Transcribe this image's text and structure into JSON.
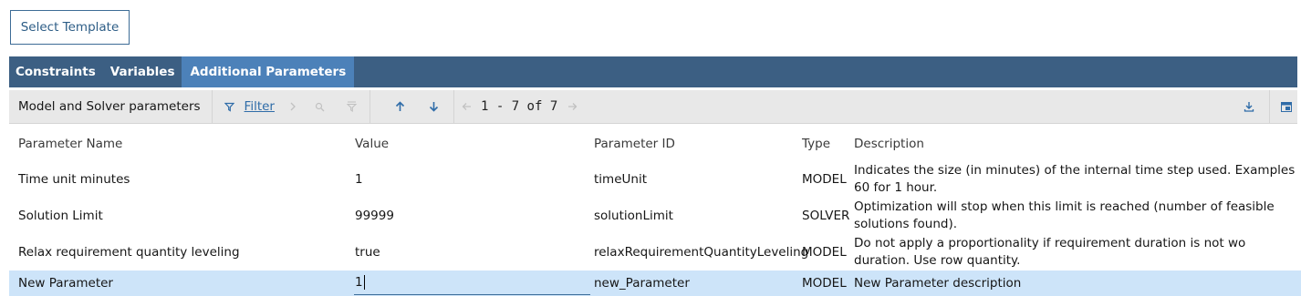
{
  "select_template_label": "Select Template",
  "tabs": [
    {
      "label": "Constraints",
      "active": false
    },
    {
      "label": "Variables",
      "active": false
    },
    {
      "label": "Additional Parameters",
      "active": true
    }
  ],
  "toolbar": {
    "title": "Model and Solver parameters",
    "filter_label": "Filter",
    "pager_text": "1 - 7 of 7",
    "icons": [
      "filter-icon",
      "chevron-right-icon",
      "search-icon",
      "clear-filter-icon",
      "arrow-up-icon",
      "arrow-down-icon",
      "arrow-left-icon",
      "arrow-right-icon",
      "download-icon",
      "panel-icon"
    ]
  },
  "columns": {
    "name": "Parameter Name",
    "value": "Value",
    "id": "Parameter ID",
    "type": "Type",
    "description": "Description"
  },
  "rows": [
    {
      "name": "Time unit minutes",
      "value": "1",
      "id": "timeUnit",
      "type": "MODEL",
      "description": "Indicates the size (in minutes) of the internal time step used. Examples 60 for 1 hour."
    },
    {
      "name": "Solution Limit",
      "value": "99999",
      "id": "solutionLimit",
      "type": "SOLVER",
      "description": "Optimization will stop when this limit is reached (number of feasible solutions found)."
    },
    {
      "name": "Relax requirement quantity leveling",
      "value": "true",
      "id": "relaxRequirementQuantityLeveling",
      "type": "MODEL",
      "description": "Do not apply a proportionality if requirement duration is not wo duration. Use row quantity."
    },
    {
      "name": "New Parameter",
      "value": "1",
      "id": "new_Parameter",
      "type": "MODEL",
      "description": "New Parameter description",
      "selected": true,
      "editing": true
    }
  ],
  "colors": {
    "tabbar": "#3c5f83",
    "active_tab": "#4c81b9",
    "toolbar_bg": "#e8e8e8",
    "selected_row": "#cde4f9",
    "link": "#2f6ca8"
  }
}
